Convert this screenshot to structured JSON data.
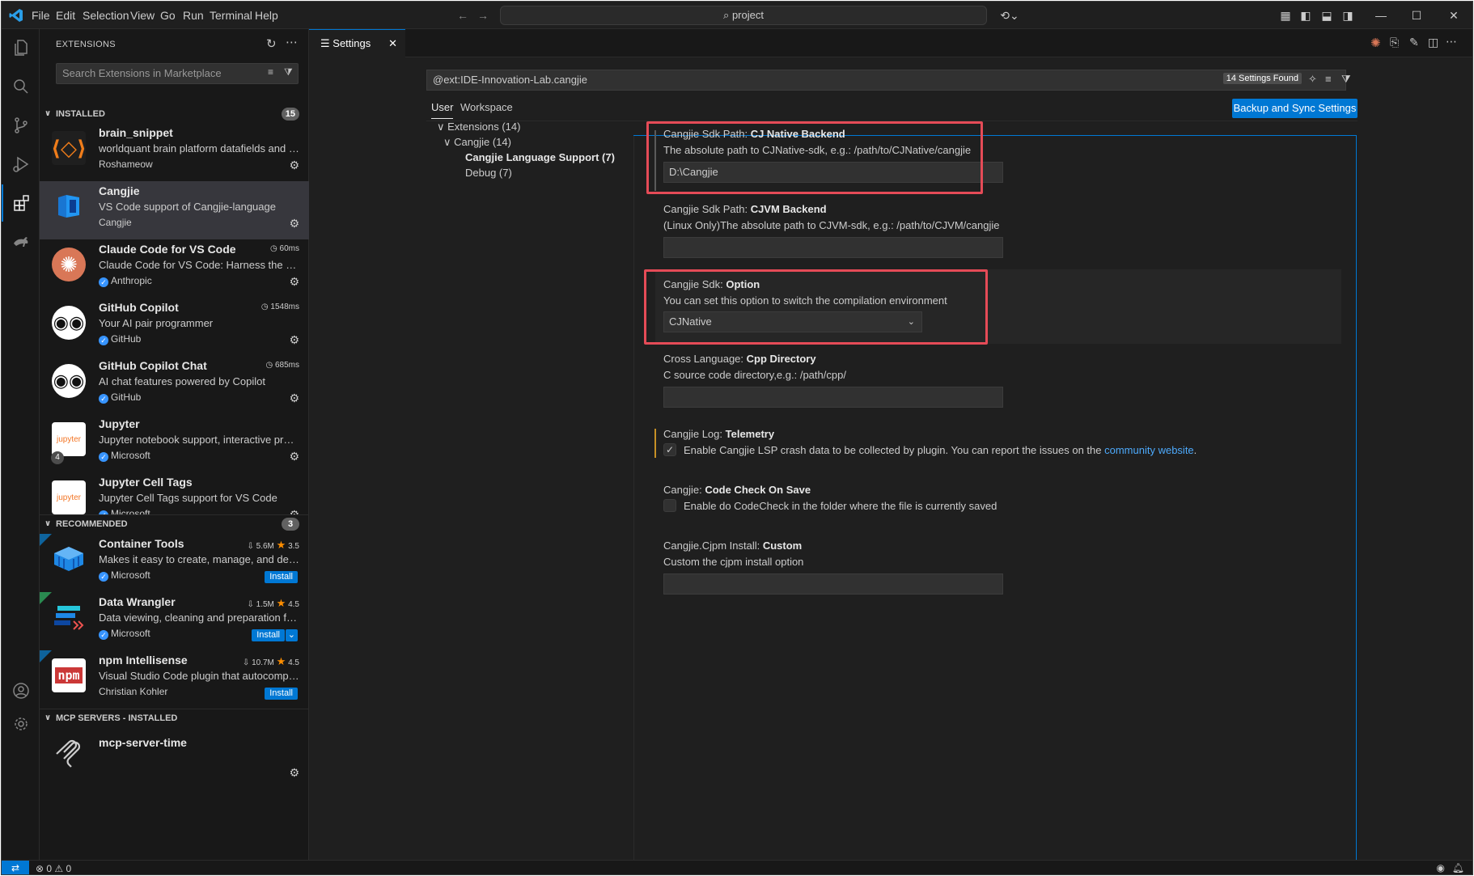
{
  "menu": [
    "File",
    "Edit",
    "Selection",
    "View",
    "Go",
    "Run",
    "Terminal",
    "Help"
  ],
  "titlebar": {
    "search": "project"
  },
  "sidebar": {
    "title": "EXTENSIONS",
    "search_placeholder": "Search Extensions in Marketplace",
    "installed": {
      "label": "INSTALLED",
      "count": "15"
    },
    "recommended": {
      "label": "RECOMMENDED",
      "count": "3"
    },
    "mcp": {
      "label": "MCP SERVERS - INSTALLED"
    },
    "installed_items": [
      {
        "name": "brain_snippet",
        "desc": "worldquant brain platform datafields and operators",
        "publisher": "Roshameow",
        "meta": ""
      },
      {
        "name": "Cangjie",
        "desc": "VS Code support of Cangjie-language",
        "publisher": "Cangjie",
        "meta": ""
      },
      {
        "name": "Claude Code for VS Code",
        "desc": "Claude Code for VS Code: Harness the power of Claude",
        "publisher": "Anthropic",
        "meta": "60ms"
      },
      {
        "name": "GitHub Copilot",
        "desc": "Your AI pair programmer",
        "publisher": "GitHub",
        "meta": "1548ms"
      },
      {
        "name": "GitHub Copilot Chat",
        "desc": "AI chat features powered by Copilot",
        "publisher": "GitHub",
        "meta": "685ms"
      },
      {
        "name": "Jupyter",
        "desc": "Jupyter notebook support, interactive programming",
        "publisher": "Microsoft",
        "meta": ""
      },
      {
        "name": "Jupyter Cell Tags",
        "desc": "Jupyter Cell Tags support for VS Code",
        "publisher": "Microsoft",
        "meta": ""
      }
    ],
    "recommended_items": [
      {
        "name": "Container Tools",
        "desc": "Makes it easy to create, manage, and debug containers",
        "publisher": "Microsoft",
        "downloads": "5.6M",
        "rating": "3.5",
        "install": "Install"
      },
      {
        "name": "Data Wrangler",
        "desc": "Data viewing, cleaning and preparation for tabular data",
        "publisher": "Microsoft",
        "downloads": "1.5M",
        "rating": "4.5",
        "install": "Install"
      },
      {
        "name": "npm Intellisense",
        "desc": "Visual Studio Code plugin that autocompletes npm modules",
        "publisher": "Christian Kohler",
        "downloads": "10.7M",
        "rating": "4.5",
        "install": "Install"
      }
    ],
    "mcp_items": [
      {
        "name": "mcp-server-time"
      }
    ],
    "jupyter_badge": "4"
  },
  "tab": {
    "label": "Settings"
  },
  "settings": {
    "search": "@ext:IDE-Innovation-Lab.cangjie",
    "found": "14 Settings Found",
    "scopes": [
      "User",
      "Workspace"
    ],
    "sync_button": "Backup and Sync Settings",
    "toc": [
      "Extensions (14)",
      "Cangjie (14)",
      "Cangjie Language Support (7)",
      "Debug (7)"
    ],
    "items": [
      {
        "cat": "Cangjie Sdk Path: ",
        "key": "CJ Native Backend",
        "desc": "The absolute path to CJNative-sdk, e.g.: /path/to/CJNative/cangjie",
        "value": "D:\\Cangjie"
      },
      {
        "cat": "Cangjie Sdk Path: ",
        "key": "CJVM Backend",
        "desc": "(Linux Only)The absolute path to CJVM-sdk, e.g.: /path/to/CJVM/cangjie",
        "value": ""
      },
      {
        "cat": "Cangjie Sdk: ",
        "key": "Option",
        "desc": "You can set this option to switch the compilation environment",
        "value": "CJNative"
      },
      {
        "cat": "Cross Language: ",
        "key": "Cpp Directory",
        "desc": "C source code directory,e.g.: /path/cpp/",
        "value": ""
      },
      {
        "cat": "Cangjie Log: ",
        "key": "Telemetry",
        "desc": "Enable Cangjie LSP crash data to be collected by plugin. You can report the issues on the ",
        "link": "community website",
        "desc_end": ".",
        "checked": true
      },
      {
        "cat": "Cangjie: ",
        "key": "Code Check On Save",
        "desc": "Enable do CodeCheck in the folder where the file is currently saved",
        "checked": false
      },
      {
        "cat": "Cangjie.Cjpm Install: ",
        "key": "Custom",
        "desc": "Custom the cjpm install option",
        "value": ""
      }
    ]
  },
  "statusbar": {
    "errors": "0",
    "warnings": "0"
  }
}
